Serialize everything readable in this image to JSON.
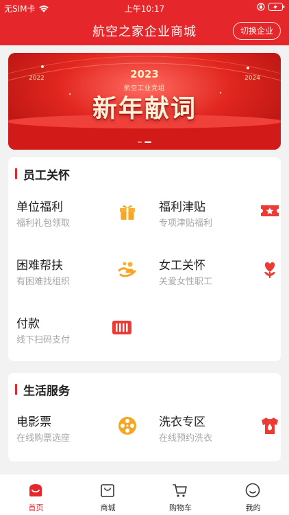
{
  "status_bar": {
    "carrier": "无SIM卡",
    "time": "上午10:17"
  },
  "nav": {
    "title": "航空之家企业商城",
    "switch_label": "切换企业"
  },
  "banner": {
    "year": "2023",
    "subtitle": "航空工业党组",
    "left_year": "2022",
    "right_year": "2024",
    "title": "新年献词"
  },
  "sections": [
    {
      "title": "员工关怀",
      "items": [
        {
          "name": "单位福利",
          "desc": "福利礼包领取",
          "icon": "gift-icon"
        },
        {
          "name": "福利津贴",
          "desc": "专项津贴福利",
          "icon": "ticket-icon"
        },
        {
          "name": "困难帮扶",
          "desc": "有困难找组织",
          "icon": "helping-hand-icon"
        },
        {
          "name": "女工关怀",
          "desc": "关爱女性职工",
          "icon": "heart-flower-icon"
        },
        {
          "name": "付款",
          "desc": "线下扫码支付",
          "icon": "barcode-icon"
        }
      ]
    },
    {
      "title": "生活服务",
      "items": [
        {
          "name": "电影票",
          "desc": "在线购票选座",
          "icon": "film-reel-icon"
        },
        {
          "name": "洗衣专区",
          "desc": "在线预约洗衣",
          "icon": "tshirt-icon"
        }
      ]
    }
  ],
  "tabbar": {
    "tabs": [
      {
        "label": "首页",
        "icon": "home-icon",
        "active": true
      },
      {
        "label": "商城",
        "icon": "shopping-bag-icon",
        "active": false
      },
      {
        "label": "购物车",
        "icon": "cart-icon",
        "active": false
      },
      {
        "label": "我的",
        "icon": "smiley-icon",
        "active": false
      }
    ]
  },
  "colors": {
    "brand_red": "#e5262b",
    "icon_orange": "#f5a623",
    "muted_text": "#a6a6a6"
  }
}
